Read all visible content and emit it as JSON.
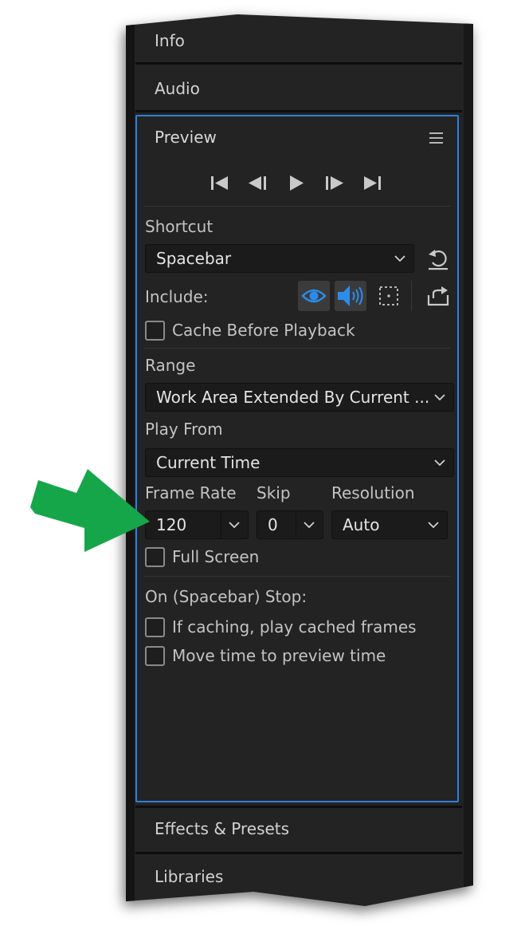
{
  "tabs": {
    "info": "Info",
    "audio": "Audio",
    "effects_presets": "Effects & Presets",
    "libraries": "Libraries"
  },
  "preview": {
    "title": "Preview",
    "menu_icon": "hamburger-menu-icon",
    "transport_icons": [
      "first-frame-icon",
      "previous-frame-icon",
      "play-icon",
      "next-frame-icon",
      "last-frame-icon"
    ],
    "shortcut": {
      "label": "Shortcut",
      "value": "Spacebar"
    },
    "include": {
      "label": "Include:",
      "video_on": true,
      "audio_on": true,
      "overlays_on": false
    },
    "cache_before_playback": {
      "label": "Cache Before Playback",
      "checked": false
    },
    "range": {
      "label": "Range",
      "value": "Work Area Extended By Current ..."
    },
    "play_from": {
      "label": "Play From",
      "value": "Current Time"
    },
    "frame_rate": {
      "label": "Frame Rate",
      "value": "120"
    },
    "skip": {
      "label": "Skip",
      "value": "0"
    },
    "resolution": {
      "label": "Resolution",
      "value": "Auto"
    },
    "full_screen": {
      "label": "Full Screen",
      "checked": false
    },
    "on_stop": {
      "label": "On (Spacebar) Stop:",
      "if_caching": {
        "label": "If caching, play cached frames",
        "checked": false
      },
      "move_time": {
        "label": "Move time to preview time",
        "checked": false
      }
    }
  },
  "colors": {
    "panel_bg": "#232323",
    "focus_border": "#2d80d9",
    "toggle_active_bg": "#3b3b3b",
    "toggle_blue": "#2d8ceb",
    "arrow": "#16a64a"
  }
}
